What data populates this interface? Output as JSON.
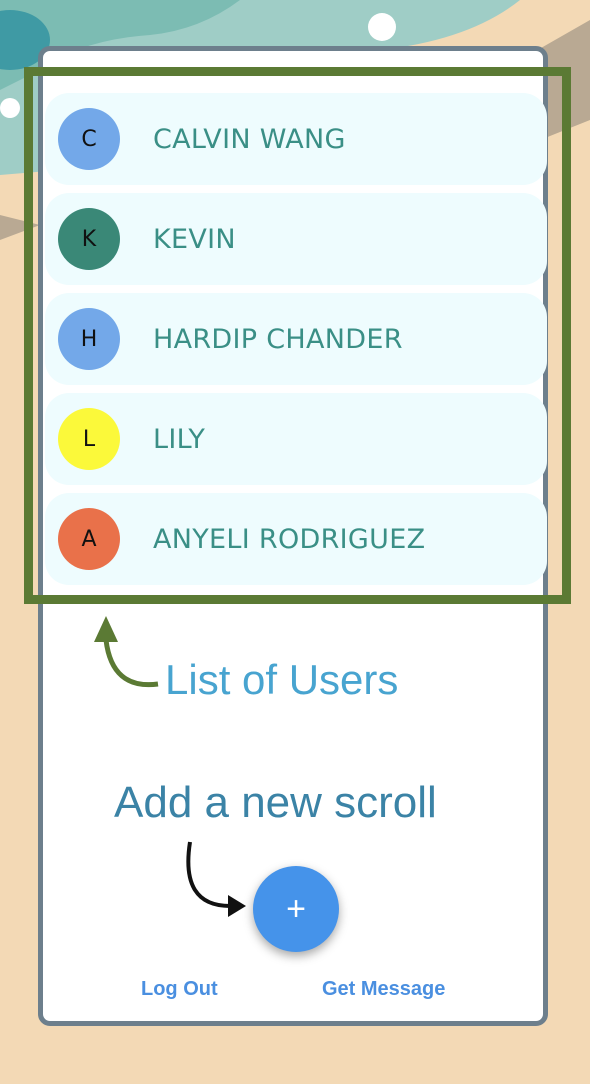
{
  "users": [
    {
      "initial": "C",
      "name": "CALVIN WANG",
      "avatar_color": "#73a8e9"
    },
    {
      "initial": "K",
      "name": "KEVIN",
      "avatar_color": "#3a8877"
    },
    {
      "initial": "H",
      "name": "HARDIP CHANDER",
      "avatar_color": "#73a8e9"
    },
    {
      "initial": "L",
      "name": "LILY",
      "avatar_color": "#fbf93a"
    },
    {
      "initial": "A",
      "name": "ANYELI RODRIGUEZ",
      "avatar_color": "#e9714a"
    }
  ],
  "annotations": {
    "list_label": "List of Users",
    "add_label": "Add a new scroll"
  },
  "fab": {
    "label": "+",
    "color": "#4593ea"
  },
  "footer": {
    "logout_label": "Log Out",
    "get_message_label": "Get Message"
  },
  "colors": {
    "highlight": "#5b7a34",
    "background": "#f3d9b5",
    "teal": "#78bfb4"
  }
}
